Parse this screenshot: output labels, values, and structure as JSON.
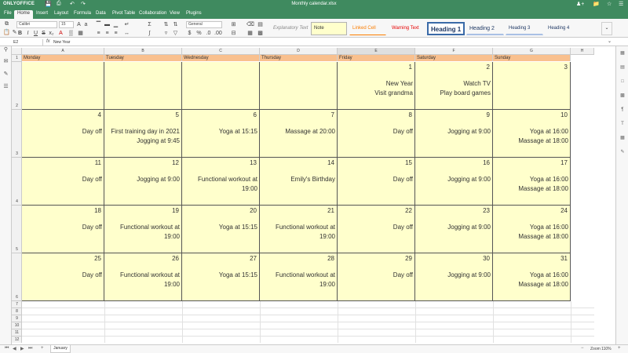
{
  "app": {
    "logo": "ONLYOFFICE",
    "doc_title": "Monthly calendar.xlsx"
  },
  "menu": {
    "tabs": [
      "File",
      "Home",
      "Insert",
      "Layout",
      "Formula",
      "Data",
      "Pivot Table",
      "Collaboration",
      "View",
      "Plugins"
    ],
    "active": "Home"
  },
  "toolbar": {
    "font_name": "Calibri",
    "font_size": "15",
    "number_format": "General",
    "styles": [
      "Explanatory Text",
      "Note",
      "Linked Cell",
      "Warning Text",
      "Heading 1",
      "Heading 2",
      "Heading 3",
      "Heading 4"
    ]
  },
  "formula": {
    "cell_ref": "E2",
    "fx": "fx",
    "value": "New Year"
  },
  "columns": [
    "A",
    "B",
    "C",
    "D",
    "E",
    "F",
    "G",
    "H"
  ],
  "selected_column": "E",
  "days": [
    "Monday",
    "Tuesday",
    "Wednesday",
    "Thursday",
    "Friday",
    "Saturday",
    "Sunday"
  ],
  "rows": [
    "1",
    "2",
    "3",
    "4",
    "5",
    "6",
    "7",
    "8",
    "9",
    "10",
    "11",
    "12"
  ],
  "calendar": [
    [
      {
        "n": "",
        "e": []
      },
      {
        "n": "",
        "e": []
      },
      {
        "n": "",
        "e": []
      },
      {
        "n": "",
        "e": []
      },
      {
        "n": "1",
        "e": [
          "New Year",
          "Visit grandma"
        ]
      },
      {
        "n": "2",
        "e": [
          "Watch TV",
          "Play board games"
        ]
      },
      {
        "n": "3",
        "e": []
      }
    ],
    [
      {
        "n": "4",
        "e": [
          "Day off"
        ]
      },
      {
        "n": "5",
        "e": [
          "First training day in 2021",
          "Jogging at 9:45"
        ]
      },
      {
        "n": "6",
        "e": [
          "Yoga at 15:15"
        ]
      },
      {
        "n": "7",
        "e": [
          "Massage at 20:00"
        ]
      },
      {
        "n": "8",
        "e": [
          "Day off"
        ]
      },
      {
        "n": "9",
        "e": [
          "Jogging at 9:00"
        ]
      },
      {
        "n": "10",
        "e": [
          "Yoga at 16:00",
          "Massage at 18:00"
        ]
      }
    ],
    [
      {
        "n": "11",
        "e": [
          "Day off"
        ]
      },
      {
        "n": "12",
        "e": [
          "Jogging at 9:00"
        ]
      },
      {
        "n": "13",
        "e": [
          "Functional workout at",
          "19:00"
        ]
      },
      {
        "n": "14",
        "e": [
          "Emily's Birthday"
        ]
      },
      {
        "n": "15",
        "e": [
          "Day off"
        ]
      },
      {
        "n": "16",
        "e": [
          "Jogging at 9:00"
        ]
      },
      {
        "n": "17",
        "e": [
          "Yoga at 16:00",
          "Massage at 18:00"
        ]
      }
    ],
    [
      {
        "n": "18",
        "e": [
          "Day off"
        ]
      },
      {
        "n": "19",
        "e": [
          "Functional workout at",
          "19:00"
        ]
      },
      {
        "n": "20",
        "e": [
          "Yoga at 15:15"
        ]
      },
      {
        "n": "21",
        "e": [
          "Functional workout at",
          "19:00"
        ]
      },
      {
        "n": "22",
        "e": [
          "Day off"
        ]
      },
      {
        "n": "23",
        "e": [
          "Jogging at 9:00"
        ]
      },
      {
        "n": "24",
        "e": [
          "Yoga at 16:00",
          "Massage at 18:00"
        ]
      }
    ],
    [
      {
        "n": "25",
        "e": [
          "Day off"
        ]
      },
      {
        "n": "26",
        "e": [
          "Functional workout at",
          "19:00"
        ]
      },
      {
        "n": "27",
        "e": [
          "Yoga at 15:15"
        ]
      },
      {
        "n": "28",
        "e": [
          "Functional workout at",
          "19:00"
        ]
      },
      {
        "n": "29",
        "e": [
          "Day off"
        ]
      },
      {
        "n": "30",
        "e": [
          "Jogging at 9:00"
        ]
      },
      {
        "n": "31",
        "e": [
          "Yoga at 16:00",
          "Massage at 18:00"
        ]
      }
    ]
  ],
  "sheet": {
    "tab": "January",
    "zoom": "Zoom 110%"
  },
  "colors": {
    "brand": "#3f8a5f",
    "header_fill": "#f9c08e",
    "cell_fill": "#ffffcc"
  }
}
